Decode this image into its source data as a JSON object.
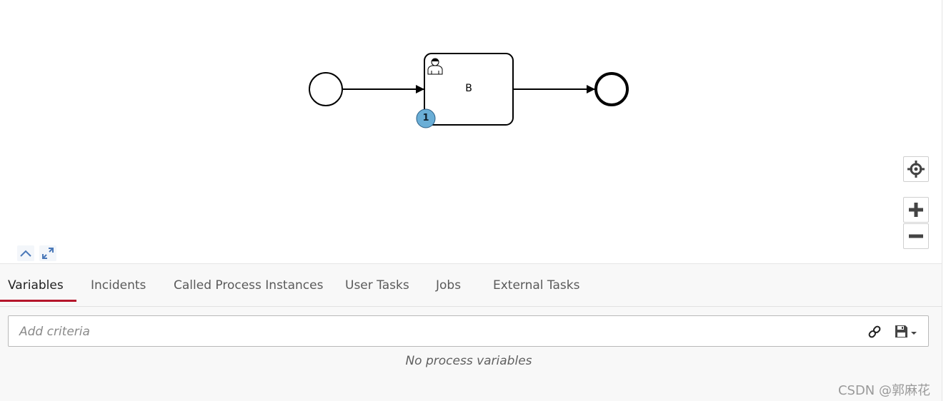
{
  "diagram": {
    "task_name": "B",
    "instance_count": "1"
  },
  "tabs": [
    {
      "label": "Variables",
      "active": true
    },
    {
      "label": "Incidents",
      "active": false
    },
    {
      "label": "Called Process Instances",
      "active": false
    },
    {
      "label": "User Tasks",
      "active": false
    },
    {
      "label": "Jobs",
      "active": false
    },
    {
      "label": "External Tasks",
      "active": false
    }
  ],
  "filter": {
    "placeholder": "Add criteria"
  },
  "variables": {
    "empty_message": "No process variables"
  },
  "watermark": "CSDN @郭麻花",
  "icons": {
    "reset": "crosshair-icon",
    "zoom_in": "plus-icon",
    "zoom_out": "minus-icon",
    "collapse": "chevron-up-icon",
    "fullscreen": "expand-icon",
    "link": "link-icon",
    "save": "floppy-disk-icon"
  },
  "colors": {
    "active_tab_underline": "#b5152b",
    "badge_fill": "#6aaed6",
    "panel_bg": "#f8f8f8"
  }
}
